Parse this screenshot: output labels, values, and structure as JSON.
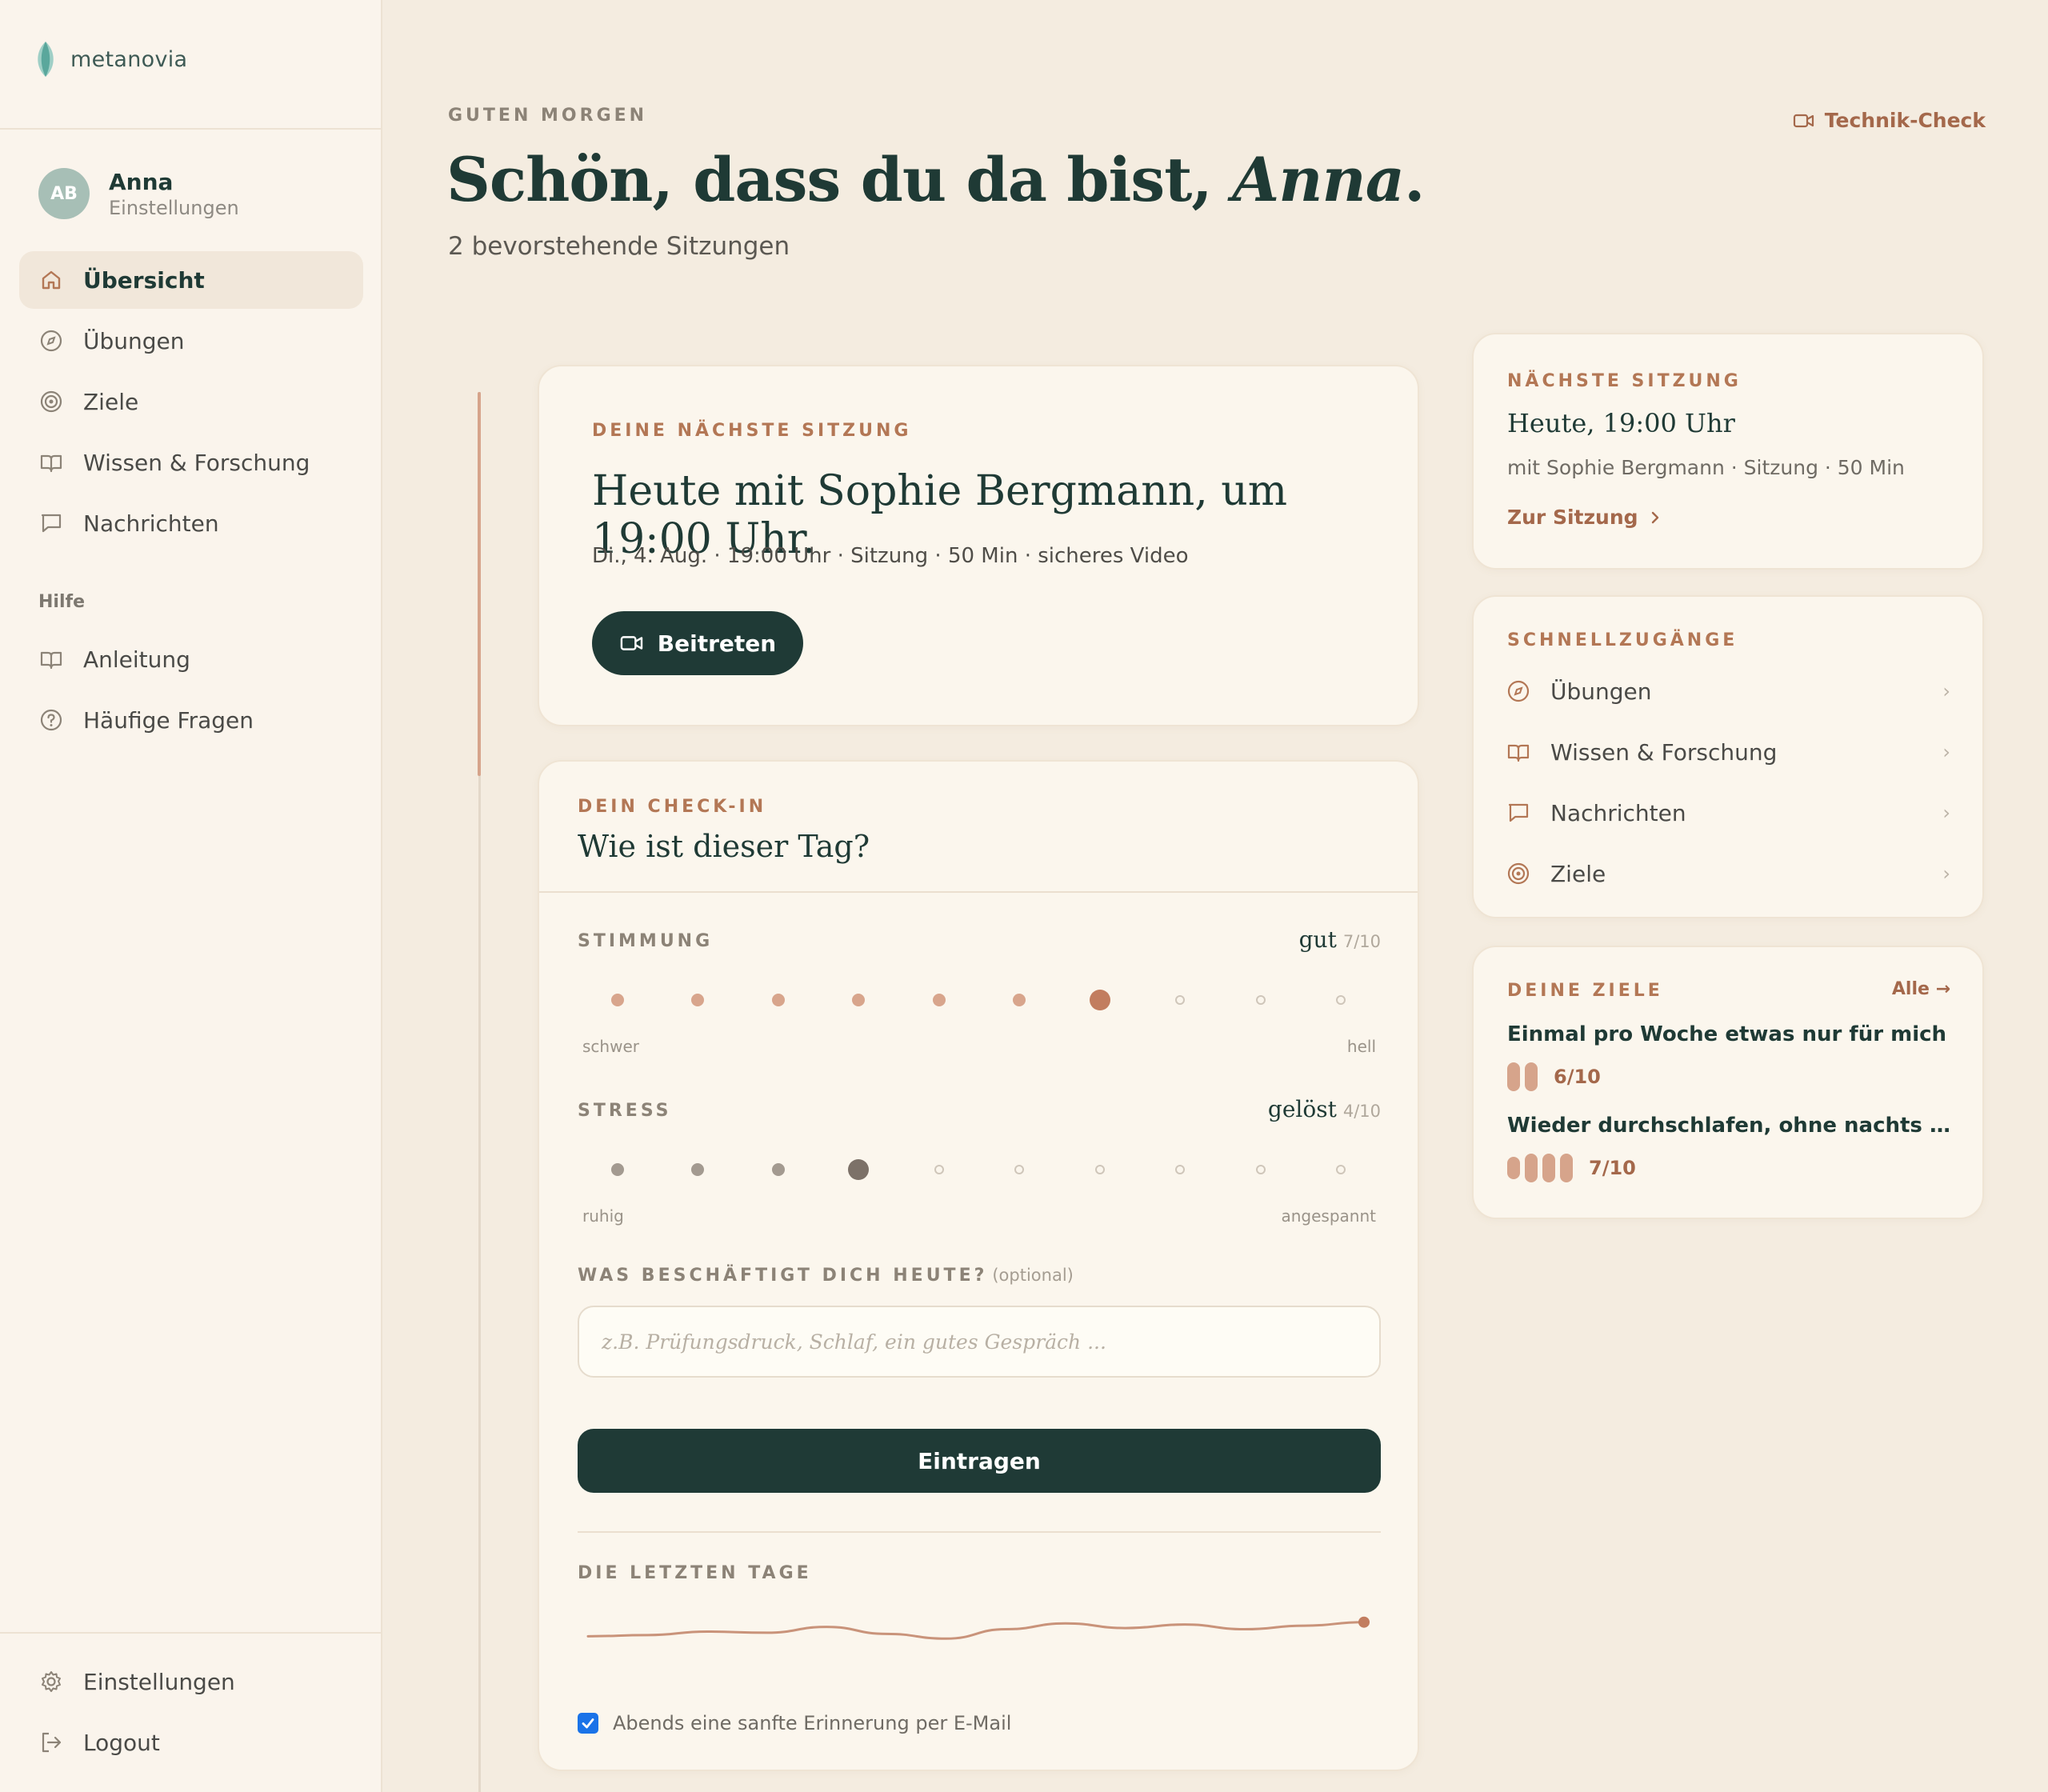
{
  "brand": {
    "name": "metanovia"
  },
  "profile": {
    "initials": "AB",
    "name": "Anna",
    "sub": "Einstellungen"
  },
  "nav": {
    "items": [
      {
        "label": "Übersicht"
      },
      {
        "label": "Übungen"
      },
      {
        "label": "Ziele"
      },
      {
        "label": "Wissen & Forschung"
      },
      {
        "label": "Nachrichten"
      }
    ],
    "help_title": "Hilfe",
    "help_items": [
      {
        "label": "Anleitung"
      },
      {
        "label": "Häufige Fragen"
      }
    ],
    "bottom_items": [
      {
        "label": "Einstellungen"
      },
      {
        "label": "Logout"
      }
    ]
  },
  "header": {
    "eyebrow": "GUTEN MORGEN",
    "title_prefix": "Schön, dass du da bist, ",
    "title_name": "Anna",
    "title_suffix": ".",
    "subtitle": "2 bevorstehende Sitzungen",
    "tech_check": "Technik-Check"
  },
  "session": {
    "eyebrow": "DEINE NÄCHSTE SITZUNG",
    "title": "Heute mit Sophie Bergmann, um 19:00 Uhr.",
    "meta": "Di., 4. Aug. · 19:00 Uhr · Sitzung · 50 Min · sicheres Video",
    "join_label": "Beitreten"
  },
  "checkin": {
    "eyebrow": "DEIN CHECK-IN",
    "question": "Wie ist dieser Tag?",
    "mood": {
      "label": "STIMMUNG",
      "value_word": "gut",
      "value_score": "7/10",
      "selected": 7,
      "max": 10,
      "low": "schwer",
      "high": "hell"
    },
    "stress": {
      "label": "STRESS",
      "value_word": "gelöst",
      "value_score": "4/10",
      "selected": 4,
      "max": 10,
      "low": "ruhig",
      "high": "angespannt"
    },
    "field_label": "WAS BESCHÄFTIGT DICH HEUTE?",
    "field_optional": "(optional)",
    "field_placeholder": "z.B. Prüfungsdruck, Schlaf, ein gutes Gespräch ...",
    "submit": "Eintragen",
    "recent_label": "DIE LETZTEN TAGE",
    "recent_values": [
      5,
      5.1,
      5.4,
      5.3,
      5.8,
      5.2,
      4.8,
      5.6,
      6.1,
      5.7,
      6.0,
      5.6,
      5.9,
      6.2
    ],
    "reminder": "Abends eine sanfte Erinnerung per E-Mail",
    "reminder_checked": true
  },
  "next": {
    "eyebrow": "NÄCHSTE SITZUNG",
    "time": "Heute, 19:00 Uhr",
    "meta": "mit Sophie Bergmann · Sitzung · 50 Min",
    "link": "Zur Sitzung"
  },
  "quick": {
    "eyebrow": "SCHNELLZUGÄNGE",
    "items": [
      {
        "label": "Übungen"
      },
      {
        "label": "Wissen & Forschung"
      },
      {
        "label": "Nachrichten"
      },
      {
        "label": "Ziele"
      }
    ]
  },
  "goals": {
    "eyebrow": "DEINE ZIELE",
    "all_label": "Alle →",
    "items": [
      {
        "title": "Einmal pro Woche etwas nur für mich",
        "score": "6/10",
        "bars": 2
      },
      {
        "title": "Wieder durchschlafen, ohne nachts zu ...",
        "score": "7/10",
        "bars": 4
      }
    ]
  },
  "colors": {
    "accent": "#b37755",
    "dark": "#1f3a36",
    "mood_dot": "#d8a58c",
    "stress_dot": "#a39a90"
  }
}
